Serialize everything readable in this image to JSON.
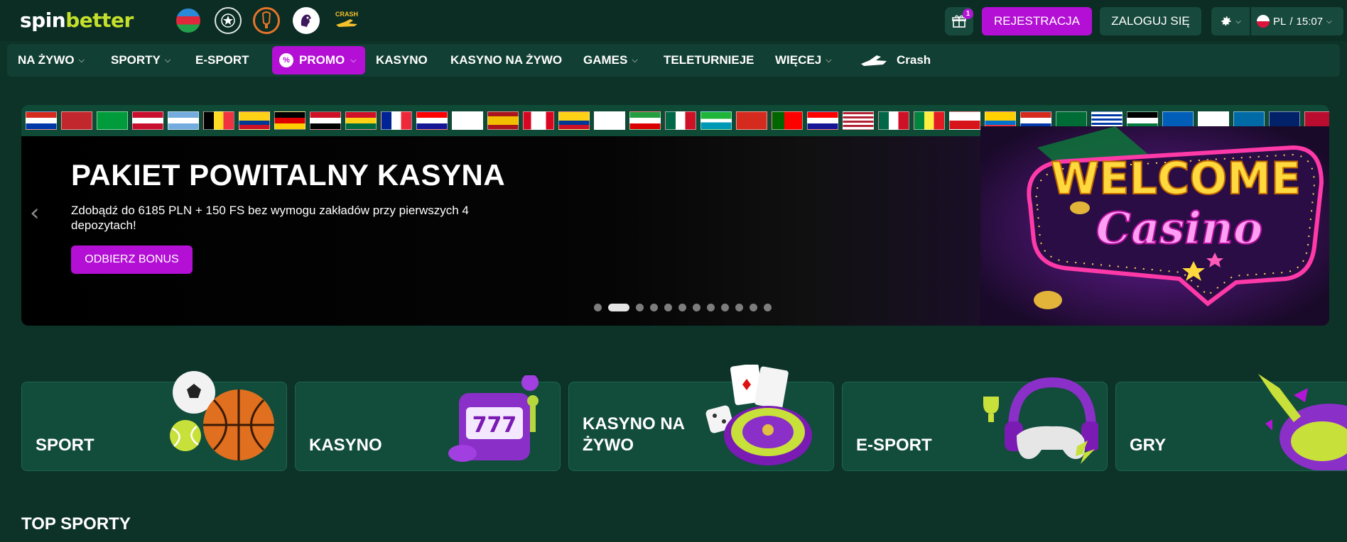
{
  "header": {
    "logo_part1": "spin",
    "logo_part2": "better",
    "league_icons": [
      "azerbaijan-flag-icon",
      "champions-league-icon",
      "europa-league-icon",
      "premier-league-icon",
      "crash-game-icon"
    ],
    "crash_mini_label": "CRASH",
    "gift_badge": "1",
    "register_label": "REJESTRACJA",
    "login_label": "ZALOGUJ SIĘ",
    "language": "PL",
    "time_separator": "/",
    "time": "15:07"
  },
  "nav": {
    "items": [
      {
        "label": "NA ŻYWO",
        "has_dropdown": true
      },
      {
        "label": "SPORTY",
        "has_dropdown": true
      },
      {
        "label": "E-SPORT",
        "has_dropdown": false
      },
      {
        "label": "PROMO",
        "has_dropdown": true,
        "highlighted": true
      },
      {
        "label": "KASYNO",
        "has_dropdown": false
      },
      {
        "label": "KASYNO NA ŻYWO",
        "has_dropdown": false
      },
      {
        "label": "GAMES",
        "has_dropdown": true
      },
      {
        "label": "TELETURNIEJE",
        "has_dropdown": false
      },
      {
        "label": "WIĘCEJ",
        "has_dropdown": true
      },
      {
        "label": "Crash",
        "has_dropdown": false
      }
    ]
  },
  "banner": {
    "title": "PAKIET POWITALNY KASYNA",
    "description": "Zdobądź do 6185 PLN + 150 FS bez wymogu zakładów przy pierwszych 4 depozytach!",
    "cta_label": "ODBIERZ BONUS",
    "slide_count": 12,
    "active_slide": 2,
    "sign_line1": "WELCOME",
    "sign_line2": "Casino"
  },
  "categories": [
    {
      "label": "SPORT"
    },
    {
      "label": "KASYNO"
    },
    {
      "label": "KASYNO NA ŻYWO"
    },
    {
      "label": "E-SPORT"
    },
    {
      "label": "GRY"
    }
  ],
  "sections": {
    "top_sports_title": "TOP SPORTY"
  },
  "colors": {
    "page_bg": "#0d3328",
    "header_bg": "#0b2d24",
    "nav_bg": "#123f33",
    "accent_purple": "#b30fd5",
    "card_bg": "#124c3b",
    "logo_green": "#c4e02b"
  }
}
